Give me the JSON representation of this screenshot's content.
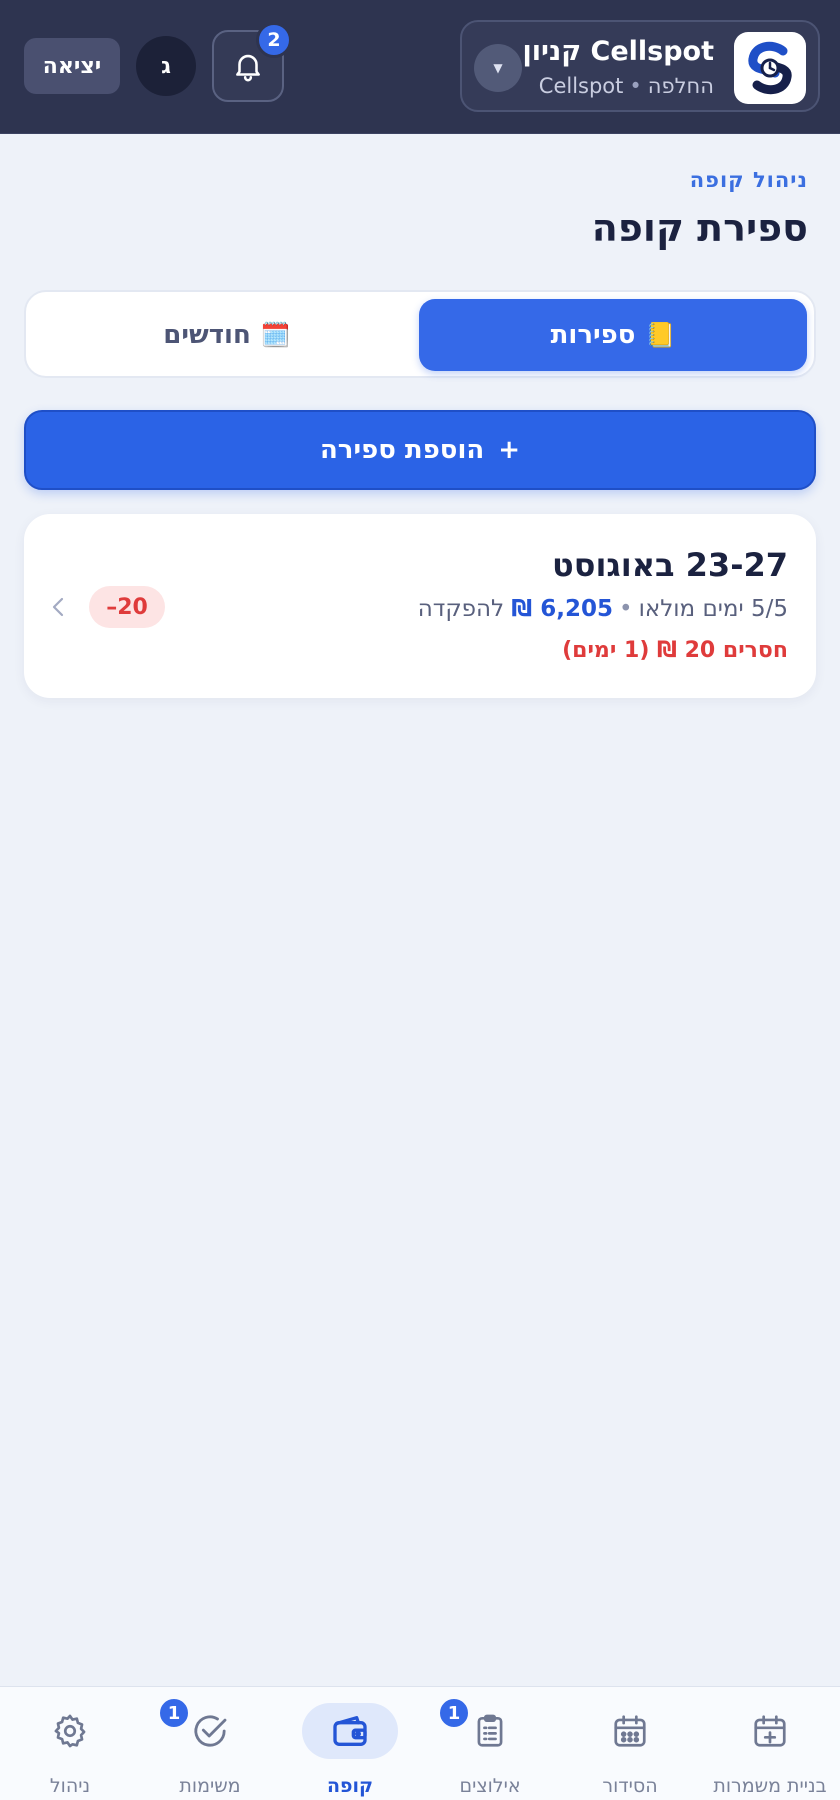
{
  "header": {
    "store_name": "Cellspot קניון",
    "store_org": "Cellspot",
    "store_switch": "החלפה",
    "notifications_count": "2",
    "avatar_initial": "ג",
    "logout_label": "יציאה"
  },
  "page": {
    "breadcrumb": "ניהול קופה",
    "title": "ספירת קופה"
  },
  "tabs": [
    {
      "label": "ספירות",
      "emoji": "📒",
      "active": true
    },
    {
      "label": "חודשים",
      "emoji": "🗓️",
      "active": false
    }
  ],
  "add_button": {
    "label": "הוספת ספירה",
    "icon": "+"
  },
  "counts": [
    {
      "title": "23-27 באוגוסט",
      "days": "5/5 ימים מולאו",
      "amount": "6,205 ₪",
      "deposit_label": "להפקדה",
      "alert": "חסרים 20 ₪ (1 ימים)",
      "diff": "–20"
    }
  ],
  "bottom_nav": [
    {
      "label": "בניית משמרות",
      "icon": "calendar-plus-icon",
      "active": false
    },
    {
      "label": "הסידור",
      "icon": "calendar-icon",
      "active": false
    },
    {
      "label": "אילוצים",
      "icon": "clipboard-icon",
      "active": false,
      "badge": "1"
    },
    {
      "label": "קופה",
      "icon": "wallet-icon",
      "active": true
    },
    {
      "label": "משימות",
      "icon": "check-circle-icon",
      "active": false,
      "badge": "1"
    },
    {
      "label": "ניהול",
      "icon": "gear-icon",
      "active": false
    }
  ],
  "colors": {
    "header_bg": "#2e3450",
    "accent": "#3569e8",
    "alert": "#df3b3b",
    "page_bg": "#eef2f9"
  }
}
